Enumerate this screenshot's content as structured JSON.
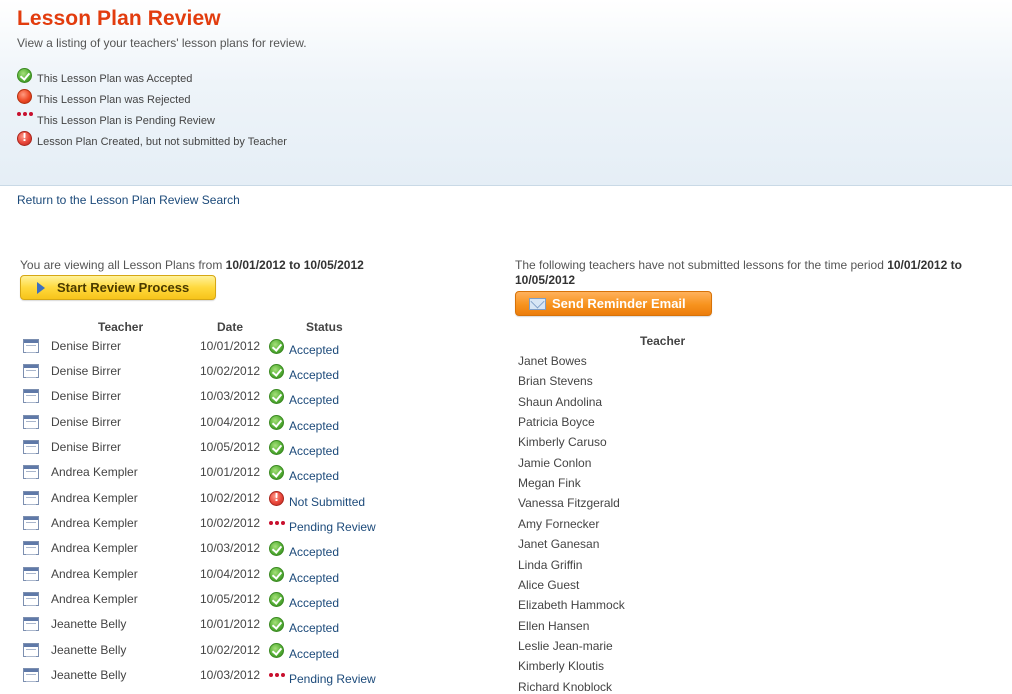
{
  "header": {
    "title": "Lesson Plan Review",
    "subtitle": "View a listing of your teachers' lesson plans for review."
  },
  "legend": [
    {
      "icon": "accepted-check-icon",
      "text": "This Lesson Plan was Accepted"
    },
    {
      "icon": "rejected-dot-icon",
      "text": "This Lesson Plan was Rejected"
    },
    {
      "icon": "pending-dots-icon",
      "text": "This Lesson Plan is Pending Review"
    },
    {
      "icon": "not-submitted-exclamation-icon",
      "text": "Lesson Plan Created, but not submitted by Teacher"
    }
  ],
  "return_link": "Return to the Lesson Plan Review Search",
  "left": {
    "viewing_prefix": "You are viewing all Lesson Plans from ",
    "date_from": "10/01/2012",
    "to_word": " to ",
    "date_to": "10/05/2012",
    "start_button": "Start Review Process",
    "columns": {
      "teacher": "Teacher",
      "date": "Date",
      "status": "Status"
    },
    "rows": [
      {
        "teacher": "Denise Birrer",
        "date": "10/01/2012",
        "status": "Accepted",
        "kind": "accepted"
      },
      {
        "teacher": "Denise Birrer",
        "date": "10/02/2012",
        "status": "Accepted",
        "kind": "accepted"
      },
      {
        "teacher": "Denise Birrer",
        "date": "10/03/2012",
        "status": "Accepted",
        "kind": "accepted"
      },
      {
        "teacher": "Denise Birrer",
        "date": "10/04/2012",
        "status": "Accepted",
        "kind": "accepted"
      },
      {
        "teacher": "Denise Birrer",
        "date": "10/05/2012",
        "status": "Accepted",
        "kind": "accepted"
      },
      {
        "teacher": "Andrea Kempler",
        "date": "10/01/2012",
        "status": "Accepted",
        "kind": "accepted"
      },
      {
        "teacher": "Andrea Kempler",
        "date": "10/02/2012",
        "status": "Not Submitted",
        "kind": "notsub"
      },
      {
        "teacher": "Andrea Kempler",
        "date": "10/02/2012",
        "status": "Pending Review",
        "kind": "pending"
      },
      {
        "teacher": "Andrea Kempler",
        "date": "10/03/2012",
        "status": "Accepted",
        "kind": "accepted"
      },
      {
        "teacher": "Andrea Kempler",
        "date": "10/04/2012",
        "status": "Accepted",
        "kind": "accepted"
      },
      {
        "teacher": "Andrea Kempler",
        "date": "10/05/2012",
        "status": "Accepted",
        "kind": "accepted"
      },
      {
        "teacher": "Jeanette Belly",
        "date": "10/01/2012",
        "status": "Accepted",
        "kind": "accepted"
      },
      {
        "teacher": "Jeanette Belly",
        "date": "10/02/2012",
        "status": "Accepted",
        "kind": "accepted"
      },
      {
        "teacher": "Jeanette Belly",
        "date": "10/03/2012",
        "status": "Pending Review",
        "kind": "pending"
      }
    ]
  },
  "right": {
    "notice_prefix": "The following teachers have not submitted lessons for the time period ",
    "date_from": "10/01/2012",
    "to_word": " to ",
    "date_to": "10/05/2012",
    "reminder_button": "Send Reminder Email",
    "column": "Teacher",
    "teachers": [
      "Janet Bowes",
      "Brian Stevens",
      "Shaun Andolina",
      "Patricia Boyce",
      "Kimberly Caruso",
      "Jamie Conlon",
      "Megan Fink",
      "Vanessa Fitzgerald",
      "Amy Fornecker",
      "Janet Ganesan",
      "Linda Griffin",
      "Alice Guest",
      "Elizabeth Hammock",
      "Ellen Hansen",
      "Leslie Jean-marie",
      "Kimberly Kloutis",
      "Richard Knoblock"
    ]
  },
  "colors": {
    "title": "#e23c0e",
    "link": "#1c4a7a",
    "accept_green": "#55b035",
    "reject_red": "#ef4a26",
    "pending_red": "#c8102e",
    "start_button_yellow": "#ffd93d",
    "reminder_button_orange": "#f7931e"
  }
}
